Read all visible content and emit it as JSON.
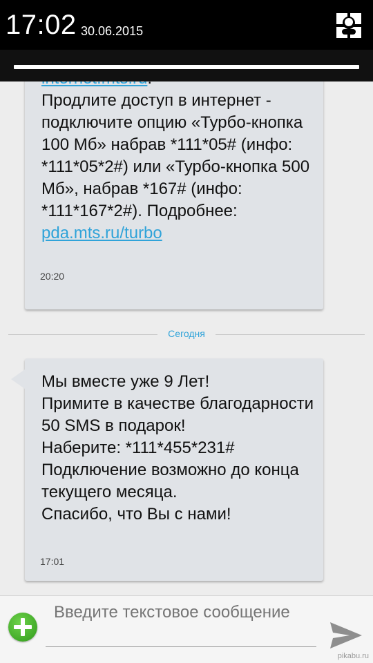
{
  "status_bar": {
    "time": "17:02",
    "date": "30.06.2015",
    "quick_settings_icon": "quick-settings-user-grid-icon"
  },
  "notification_shade": {
    "handle_icon": "shade-handle"
  },
  "messages": [
    {
      "text_top_link": "internet.mts.ru",
      "text_after_link": ".\nПродлите доступ в интернет - подключите опцию «Турбо-кнопка 100 Мб»  набрав *111*05# (инфо: *111*05*2#) или «Турбо-кнопка 500 Мб», набрав *167# (инфо: *111*167*2#). Подробнее: ",
      "text_bottom_link": "pda.mts.ru/turbo",
      "time": "20:20"
    },
    {
      "text": "Мы вместе уже 9 Лет!\nПримите в качестве благодарности 50 SMS в подарок!\nНаберите: *111*455*231#\nПодключение возможно до конца текущего месяца.\nСпасибо, что Вы с нами!",
      "time": "17:01"
    }
  ],
  "date_divider": "Сегодня",
  "composer": {
    "placeholder": "Введите текстовое сообщение",
    "attach_icon": "add-attachment-icon",
    "send_icon": "send-icon"
  },
  "watermark": "pikabu.ru",
  "colors": {
    "link": "#2fa3d9",
    "bubble": "#e0e3e7",
    "status_bar": "#000000",
    "add_button": "#3cac22"
  }
}
